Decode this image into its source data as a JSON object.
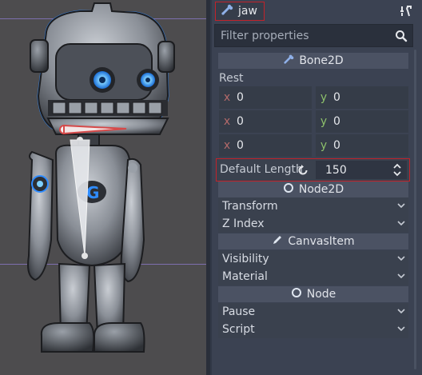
{
  "colors": {
    "accent_highlight": "#c2222a",
    "axis_x": "#b46a6a",
    "axis_y": "#8cbf6b",
    "node2d_icon": "#dfe6f0",
    "bone_icon": "#8fb0e8"
  },
  "inspector": {
    "node_name": "jaw",
    "node_icon": "bone-icon",
    "tools_icon": "object-tools-icon",
    "filter": {
      "placeholder": "Filter properties",
      "value": ""
    },
    "sections": {
      "bone2d": "Bone2D",
      "node2d": "Node2D",
      "canvasitem": "CanvasItem",
      "node": "Node"
    },
    "rest": {
      "label": "Rest",
      "rows": [
        {
          "x_label": "x",
          "x": "0",
          "y_label": "y",
          "y": "0"
        },
        {
          "x_label": "x",
          "x": "0",
          "y_label": "y",
          "y": "0"
        },
        {
          "x_label": "x",
          "x": "0",
          "y_label": "y",
          "y": "0"
        }
      ]
    },
    "default_length": {
      "label": "Default Length",
      "value": "150"
    },
    "node2d_props": [
      "Transform",
      "Z Index"
    ],
    "canvasitem_props": [
      "Visibility",
      "Material"
    ],
    "node_props": [
      "Pause",
      "Script"
    ]
  }
}
